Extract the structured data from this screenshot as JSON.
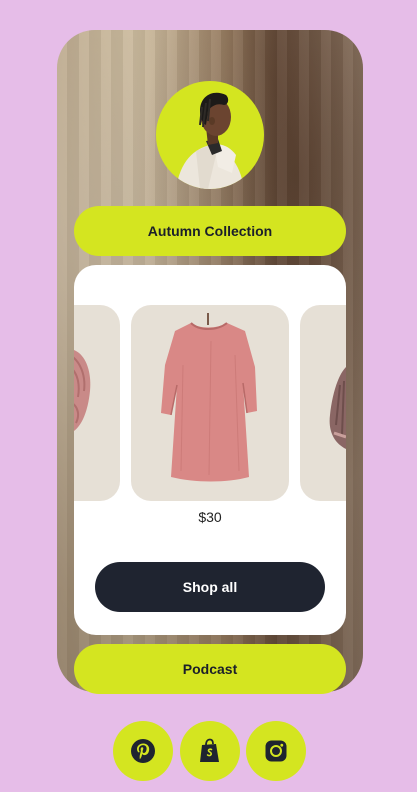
{
  "profile": {
    "avatar_icon": "profile-photo"
  },
  "links": {
    "autumn_collection_label": "Autumn Collection",
    "podcast_label": "Podcast"
  },
  "product_card": {
    "items": [
      {
        "name": "beanie",
        "price": ""
      },
      {
        "name": "pink-oversized-tee",
        "price": "$30"
      },
      {
        "name": "balaclava",
        "price": ""
      }
    ],
    "active_price": "$30",
    "shop_all_label": "Shop all"
  },
  "socials": [
    {
      "icon": "pinterest-icon"
    },
    {
      "icon": "shopify-icon"
    },
    {
      "icon": "instagram-icon"
    }
  ],
  "colors": {
    "background": "#e6bde8",
    "accent": "#d4e520",
    "dark_button": "#1f2430",
    "card": "#ffffff",
    "tile": "#e6e0d6"
  }
}
